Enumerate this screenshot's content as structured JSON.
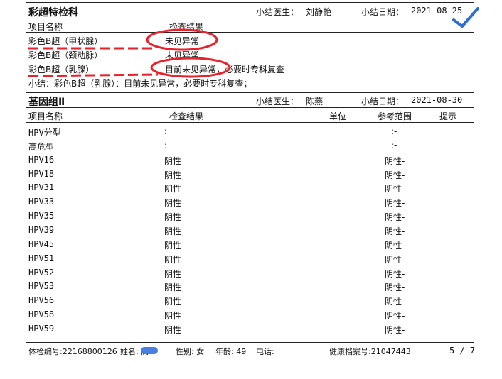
{
  "section1": {
    "title": "彩超特检科",
    "doctor_label": "小结医生：",
    "doctor_name": "刘静艳",
    "date_label": "小结日期：",
    "date": "2021-08-25",
    "col_item": "项目名称",
    "col_result": "检查结果",
    "rows": [
      {
        "name": "彩色B超（甲状腺）",
        "result": "未见异常"
      },
      {
        "name": "彩色B超（颈动脉）",
        "result": "未见异常"
      },
      {
        "name": "彩色B超（乳腺）",
        "result": "目前未见异常，必要时专科复查"
      }
    ],
    "summary": "小结：彩色B超（乳腺）：目前未见异常，必要时专科复查；"
  },
  "section2": {
    "title": "基因组Ⅱ",
    "doctor_label": "小结医生：",
    "doctor_name": "陈燕",
    "date_label": "小结日期：",
    "date": "2021-08-30",
    "col_item": "项目名称",
    "col_result": "检查结果",
    "col_unit": "单位",
    "col_ref": "参考范围",
    "col_hint": "提示",
    "rows": [
      {
        "name": "HPV分型",
        "result": ":",
        "ref": ":-"
      },
      {
        "name": "高危型",
        "result": ":",
        "ref": ":-"
      },
      {
        "name": "HPV16",
        "result": "阴性",
        "ref": "阴性-"
      },
      {
        "name": "HPV18",
        "result": "阴性",
        "ref": "阴性-"
      },
      {
        "name": "HPV31",
        "result": "阴性",
        "ref": "阴性-"
      },
      {
        "name": "HPV33",
        "result": "阴性",
        "ref": "阴性-"
      },
      {
        "name": "HPV35",
        "result": "阴性",
        "ref": "阴性-"
      },
      {
        "name": "HPV39",
        "result": "阴性",
        "ref": "阴性-"
      },
      {
        "name": "HPV45",
        "result": "阴性",
        "ref": "阴性-"
      },
      {
        "name": "HPV51",
        "result": "阴性",
        "ref": "阴性-"
      },
      {
        "name": "HPV52",
        "result": "阴性",
        "ref": "阴性-"
      },
      {
        "name": "HPV53",
        "result": "阴性",
        "ref": "阴性-"
      },
      {
        "name": "HPV56",
        "result": "阴性",
        "ref": "阴性-"
      },
      {
        "name": "HPV58",
        "result": "阴性",
        "ref": "阴性-"
      },
      {
        "name": "HPV59",
        "result": "阴性",
        "ref": "阴性-"
      }
    ]
  },
  "footer": {
    "exam_no": "体检编号:22168800126",
    "name_label": "姓名:",
    "name_visible": "高",
    "gender": "性别: 女",
    "age": "年龄: 49",
    "phone": "电话:",
    "health_record": "健康档案号:21047443",
    "page": "5 / 7"
  },
  "colors": {
    "annotation_red": "#e8212a",
    "annotation_blue": "#2b6fd6",
    "redaction_blue": "#4a7ee0"
  }
}
